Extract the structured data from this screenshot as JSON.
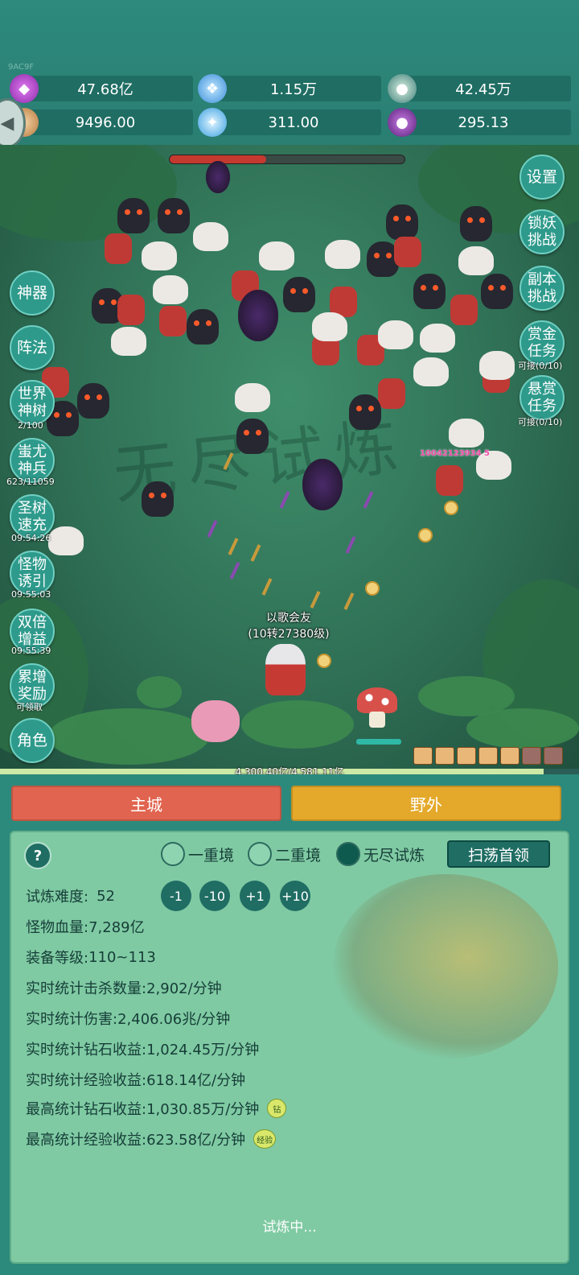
{
  "build_tag": "9AC9F",
  "resources": [
    {
      "icon": "purple-gem-icon",
      "value": "47.68亿",
      "color": "#b445d6"
    },
    {
      "icon": "blue-crystal-icon",
      "value": "1.15万",
      "color": "#4aa6e8"
    },
    {
      "icon": "orb-icon",
      "value": "42.45万",
      "color": "#47a093"
    },
    {
      "icon": "horn-icon",
      "value": "9496.00",
      "color": "#d99a5a"
    },
    {
      "icon": "ice-shard-icon",
      "value": "311.00",
      "color": "#5bb8f0"
    },
    {
      "icon": "potion-icon",
      "value": "295.13",
      "color": "#8a3cb0"
    }
  ],
  "boss_hp_fraction": 0.41,
  "right_buttons": [
    {
      "label": "设置",
      "sub": ""
    },
    {
      "label": "锁妖挑战",
      "sub": ""
    },
    {
      "label": "副本挑战",
      "sub": ""
    },
    {
      "label": "赏金任务",
      "sub": "可接(0/10)"
    },
    {
      "label": "悬赏任务",
      "sub": "可接(0/10)"
    }
  ],
  "left_buttons": [
    {
      "label": "神器",
      "sub": ""
    },
    {
      "label": "阵法",
      "sub": ""
    },
    {
      "label": "世界神树",
      "sub": "2/100"
    },
    {
      "label": "蚩尤神兵",
      "sub": "623/11059"
    },
    {
      "label": "圣树速充",
      "sub": "09:54:26"
    },
    {
      "label": "怪物诱引",
      "sub": "09:55:03"
    },
    {
      "label": "双倍增益",
      "sub": "09:55:39"
    },
    {
      "label": "累增奖励",
      "sub": "可领取"
    },
    {
      "label": "角色",
      "sub": ""
    }
  ],
  "player": {
    "name": "以歌会友",
    "level": "(10转27380级)"
  },
  "damage_number": "10042123934 5",
  "exp": {
    "text": "4,300.40亿/4,581.11亿",
    "fraction": 0.939
  },
  "tabs": {
    "main_city": "主城",
    "wild": "野外"
  },
  "colors": {
    "main_city": "#e0644f",
    "wild": "#e4a92a"
  },
  "trial": {
    "help": "?",
    "realms": [
      {
        "label": "一重境",
        "selected": false
      },
      {
        "label": "二重境",
        "selected": false
      },
      {
        "label": "无尽试炼",
        "selected": true
      }
    ],
    "sweep_label": "扫荡首领",
    "difficulty_label": "试炼难度:",
    "difficulty_value": "52",
    "difficulty_buttons": [
      "-1",
      "-10",
      "+1",
      "+10"
    ],
    "stats": [
      {
        "label": "怪物血量:",
        "value": "7,289亿",
        "badge": ""
      },
      {
        "label": "装备等级:",
        "value": "110~113",
        "badge": ""
      },
      {
        "label": "实时统计击杀数量:",
        "value": "2,902/分钟",
        "badge": ""
      },
      {
        "label": "实时统计伤害:",
        "value": "2,406.06兆/分钟",
        "badge": ""
      },
      {
        "label": "实时统计钻石收益:",
        "value": "1,024.45万/分钟",
        "badge": ""
      },
      {
        "label": "实时统计经验收益:",
        "value": "618.14亿/分钟",
        "badge": ""
      },
      {
        "label": "最高统计钻石收益:",
        "value": "1,030.85万/分钟",
        "badge": "钻"
      },
      {
        "label": "最高统计经验收益:",
        "value": "623.58亿/分钟",
        "badge": "经验"
      }
    ],
    "status": "试炼中..."
  }
}
